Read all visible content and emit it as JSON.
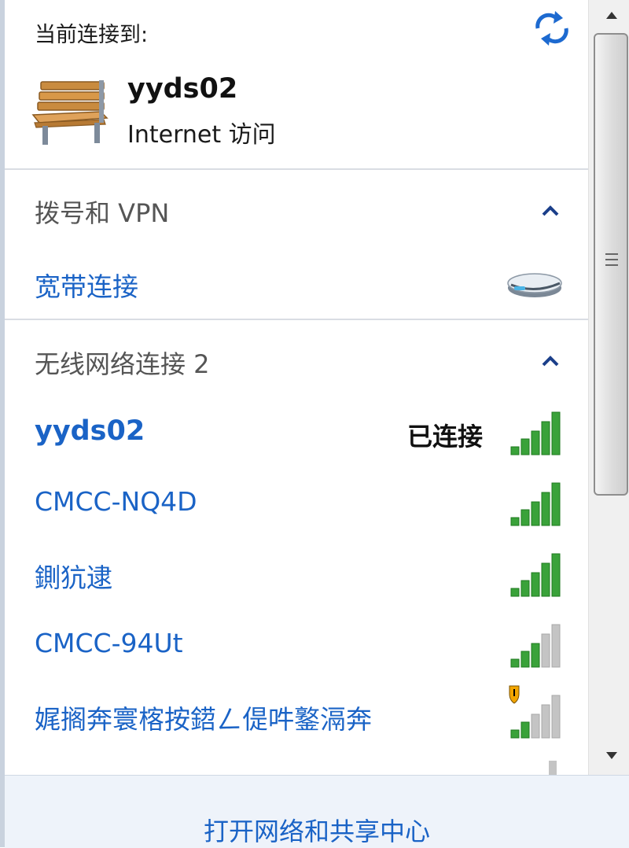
{
  "current": {
    "label": "当前连接到:",
    "network_name": "yyds02",
    "status": "Internet 访问",
    "icon": "bench-icon",
    "refresh_icon": "refresh-icon"
  },
  "dialup_section": {
    "title": "拨号和 VPN",
    "items": [
      {
        "name": "宽带连接",
        "icon": "broadband-modem-icon"
      }
    ]
  },
  "wireless_section": {
    "title": "无线网络连接 2",
    "networks": [
      {
        "name": "yyds02",
        "state": "已连接",
        "signal_bars": 5,
        "secured_warning": false
      },
      {
        "name": "CMCC-NQ4D",
        "state": "",
        "signal_bars": 5,
        "secured_warning": false
      },
      {
        "name": "鍘犺逮",
        "state": "",
        "signal_bars": 5,
        "secured_warning": false
      },
      {
        "name": "CMCC-94Ut",
        "state": "",
        "signal_bars": 3,
        "secured_warning": false
      },
      {
        "name": "娓搁奔寰楁按鍣ㄥ偍吽鐜滆奔",
        "state": "",
        "signal_bars": 2,
        "secured_warning": true
      }
    ]
  },
  "footer": {
    "link": "打开网络和共享中心"
  },
  "colors": {
    "link": "#1a63c6",
    "signal_on": "#3aa23a",
    "signal_off": "#c4c4c4",
    "footer_bg": "#eef3fa"
  }
}
